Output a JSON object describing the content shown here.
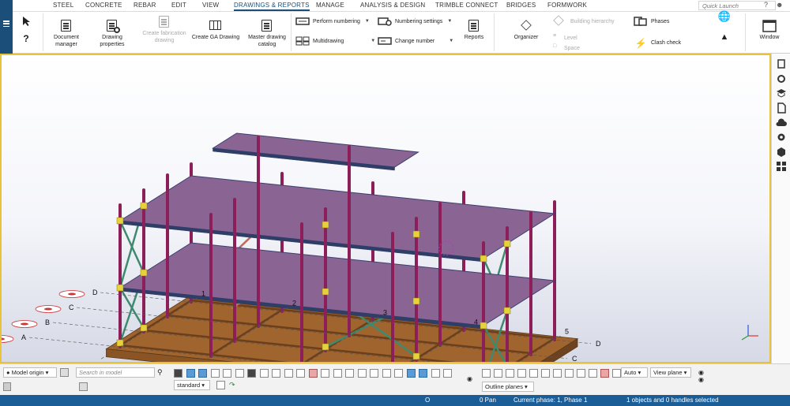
{
  "menu": {
    "items": [
      "STEEL",
      "CONCRETE",
      "REBAR",
      "EDIT",
      "VIEW",
      "DRAWINGS & REPORTS",
      "MANAGE",
      "ANALYSIS & DESIGN",
      "TRIMBLE CONNECT",
      "BRIDGES",
      "FORMWORK"
    ],
    "active": "DRAWINGS & REPORTS",
    "quick_launch_placeholder": "Quick Launch"
  },
  "ribbon": {
    "document_manager": "Document manager",
    "drawing_properties": "Drawing properties",
    "create_fabrication_drawing": "Create fabrication drawing",
    "create_ga_drawing": "Create GA Drawing",
    "master_drawing_catalog": "Master drawing catalog",
    "perform_numbering": "Perform numbering",
    "numbering_settings": "Numbering settings",
    "multidrawing": "Multidrawing",
    "change_number": "Change number",
    "reports": "Reports",
    "organizer": "Organizer",
    "building_hierarchy": "Building hierarchy",
    "level": "Level",
    "space": "Space",
    "phases": "Phases",
    "clash_check": "Clash check",
    "window": "Window"
  },
  "model": {
    "grid_letters": [
      "A",
      "B",
      "C",
      "D"
    ],
    "grid_numbers": [
      "1",
      "2",
      "3",
      "4",
      "5"
    ]
  },
  "bottom": {
    "model_origin": "Model origin",
    "search_placeholder": "Search in model",
    "standard": "standard",
    "auto": "Auto",
    "view_plane": "View plane",
    "outline_planes": "Outline planes"
  },
  "status": {
    "o": "O",
    "pan": "0 Pan",
    "phase": "Current phase: 1, Phase 1",
    "selection": "1 objects and 0 handles selected"
  },
  "colors": {
    "accent": "#1b4f7a",
    "viewport_border": "#e8c33a",
    "column": "#8c1f59",
    "slab": "#8a6594",
    "bracing": "#3f8a6e",
    "foundation": "#a0642e",
    "status_bar": "#1b5d97"
  }
}
